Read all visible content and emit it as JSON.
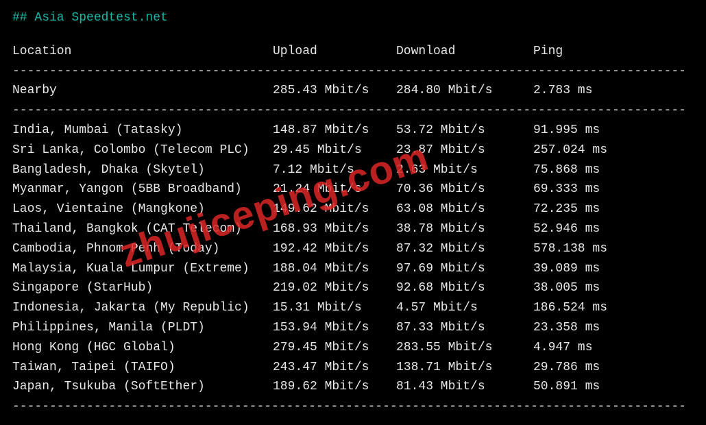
{
  "header": "## Asia Speedtest.net",
  "columns": {
    "location": "Location",
    "upload": "Upload",
    "download": "Download",
    "ping": "Ping"
  },
  "nearby": {
    "location": "Nearby",
    "upload": "285.43 Mbit/s",
    "download": "284.80 Mbit/s",
    "ping": "2.783 ms"
  },
  "servers": [
    {
      "location": "India, Mumbai (Tatasky)",
      "upload": "148.87 Mbit/s",
      "download": "53.72 Mbit/s",
      "ping": "91.995 ms"
    },
    {
      "location": "Sri Lanka, Colombo (Telecom PLC)",
      "upload": "29.45 Mbit/s",
      "download": "23.87 Mbit/s",
      "ping": "257.024 ms"
    },
    {
      "location": "Bangladesh, Dhaka (Skytel)",
      "upload": "7.12 Mbit/s",
      "download": "2.63 Mbit/s",
      "ping": "75.868 ms"
    },
    {
      "location": "Myanmar, Yangon (5BB Broadband)",
      "upload": "21.24 Mbit/s",
      "download": "70.36 Mbit/s",
      "ping": "69.333 ms"
    },
    {
      "location": "Laos, Vientaine (Mangkone)",
      "upload": "149.62 Mbit/s",
      "download": "63.08 Mbit/s",
      "ping": "72.235 ms"
    },
    {
      "location": "Thailand, Bangkok (CAT Telecom)",
      "upload": "168.93 Mbit/s",
      "download": "38.78 Mbit/s",
      "ping": "52.946 ms"
    },
    {
      "location": "Cambodia, Phnom Penh (Today)",
      "upload": "192.42 Mbit/s",
      "download": "87.32 Mbit/s",
      "ping": "578.138 ms"
    },
    {
      "location": "Malaysia, Kuala Lumpur (Extreme)",
      "upload": "188.04 Mbit/s",
      "download": "97.69 Mbit/s",
      "ping": "39.089 ms"
    },
    {
      "location": "Singapore (StarHub)",
      "upload": "219.02 Mbit/s",
      "download": "92.68 Mbit/s",
      "ping": "38.005 ms"
    },
    {
      "location": "Indonesia, Jakarta (My Republic)",
      "upload": "15.31 Mbit/s",
      "download": "4.57 Mbit/s",
      "ping": "186.524 ms"
    },
    {
      "location": "Philippines, Manila (PLDT)",
      "upload": "153.94 Mbit/s",
      "download": "87.33 Mbit/s",
      "ping": "23.358 ms"
    },
    {
      "location": "Hong Kong (HGC Global)",
      "upload": "279.45 Mbit/s",
      "download": "283.55 Mbit/s",
      "ping": "4.947 ms"
    },
    {
      "location": "Taiwan, Taipei (TAIFO)",
      "upload": "243.47 Mbit/s",
      "download": "138.71 Mbit/s",
      "ping": "29.786 ms"
    },
    {
      "location": "Japan, Tsukuba (SoftEther)",
      "upload": "189.62 Mbit/s",
      "download": "81.43 Mbit/s",
      "ping": "50.891 ms"
    }
  ],
  "divider": "-------------------------------------------------------------------------------------------",
  "watermark": "zhujiceping.com"
}
